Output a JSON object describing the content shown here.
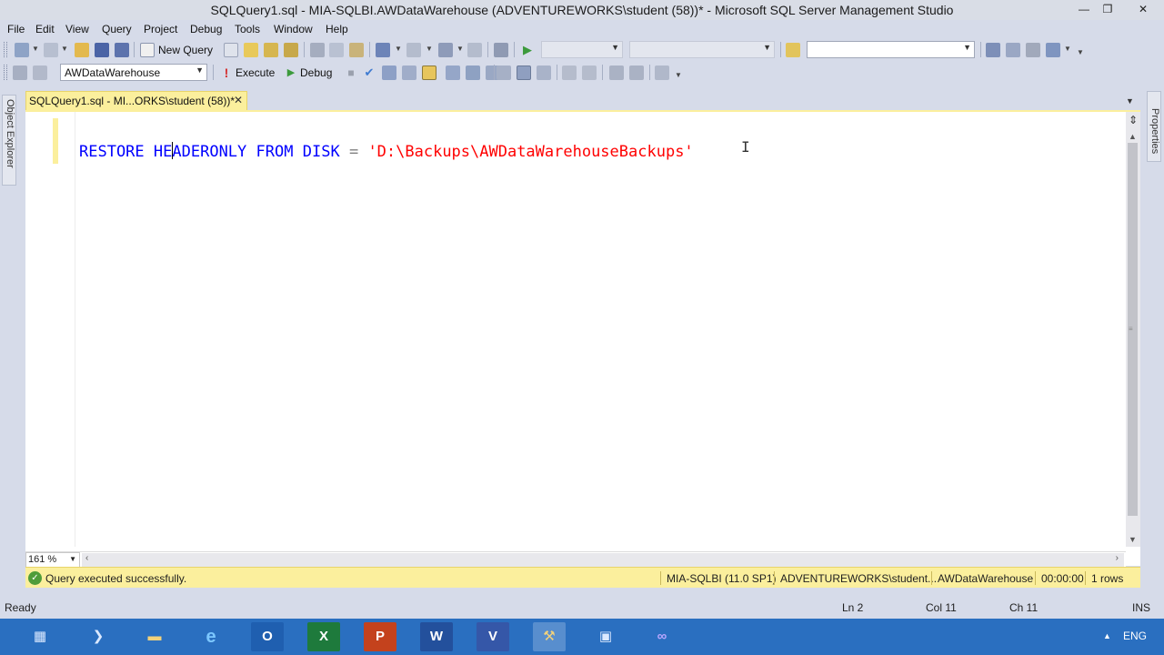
{
  "window": {
    "title": "SQLQuery1.sql - MIA-SQLBI.AWDataWarehouse (ADVENTUREWORKS\\student (58))* - Microsoft SQL Server Management Studio",
    "minimize_glyph": "—",
    "maximize_glyph": "❐",
    "close_glyph": "✕"
  },
  "menu": [
    "File",
    "Edit",
    "View",
    "Query",
    "Project",
    "Debug",
    "Tools",
    "Window",
    "Help"
  ],
  "toolbar1": {
    "new_query_label": "New Query",
    "solution_config_value": "",
    "solution_platform_value": "",
    "find_value": ""
  },
  "toolbar2": {
    "database_value": "AWDataWarehouse",
    "execute_label": "Execute",
    "debug_label": "Debug"
  },
  "side_panels": {
    "left": "Object Explorer",
    "right": "Properties"
  },
  "document_tab": {
    "label": "SQLQuery1.sql - MI...ORKS\\student (58))*",
    "close_glyph": "✕"
  },
  "editor": {
    "tokens": {
      "t1": "RESTORE",
      "t2a": "HE",
      "t2b": "ADERONLY",
      "t3": "FROM",
      "t4": "DISK",
      "t5": "=",
      "t6": "'D:\\Backups\\AWDataWarehouseBackups'"
    },
    "zoom": "161 %"
  },
  "query_status": {
    "message": "Query executed successfully.",
    "server": "MIA-SQLBI (11.0 SP1)",
    "user": "ADVENTUREWORKS\\student...",
    "database": "AWDataWarehouse",
    "elapsed": "00:00:00",
    "rows": "1 rows"
  },
  "status_bar": {
    "state": "Ready",
    "line": "Ln 2",
    "column": "Col 11",
    "character": "Ch 11",
    "insert_mode": "INS"
  },
  "taskbar": {
    "language": "ENG",
    "tray_arrow": "▲"
  },
  "colors": {
    "keyword": "#0000ff",
    "operator": "#808080",
    "string": "#ff0000",
    "tab_highlight": "#fbef9d",
    "taskbar": "#2a6fc0"
  }
}
